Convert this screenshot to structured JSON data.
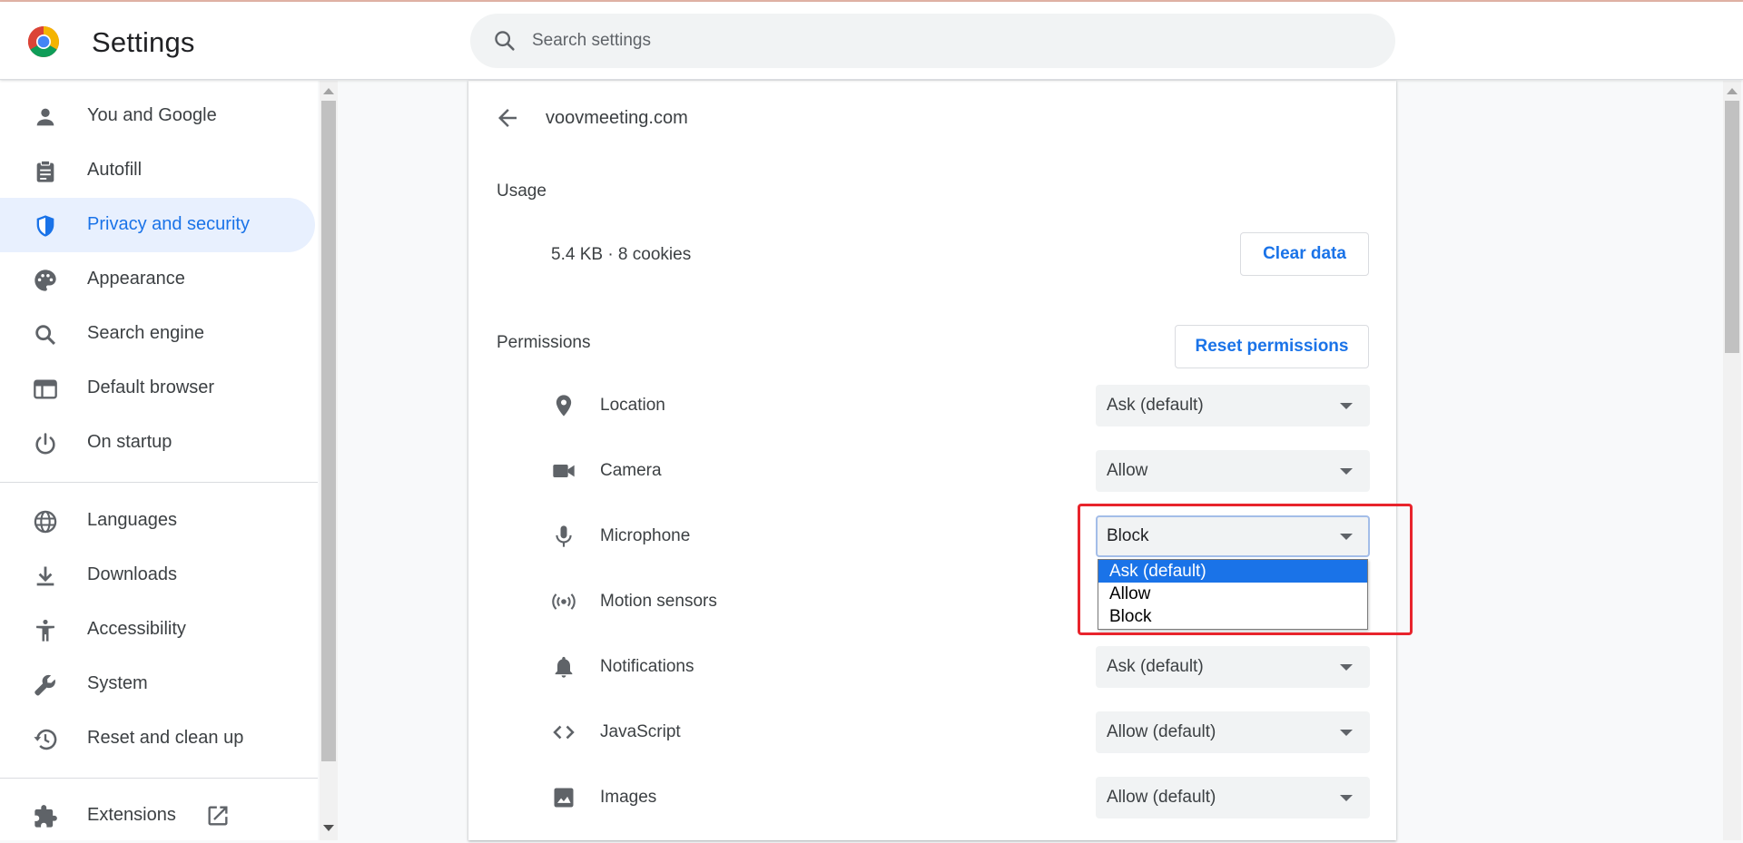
{
  "app": {
    "title": "Settings"
  },
  "search": {
    "placeholder": "Search settings"
  },
  "sidebar": {
    "items": [
      {
        "label": "You and Google",
        "icon": "person-icon"
      },
      {
        "label": "Autofill",
        "icon": "clipboard-icon"
      },
      {
        "label": "Privacy and security",
        "icon": "shield-icon",
        "active": true
      },
      {
        "label": "Appearance",
        "icon": "palette-icon"
      },
      {
        "label": "Search engine",
        "icon": "search-icon"
      },
      {
        "label": "Default browser",
        "icon": "browser-window-icon"
      },
      {
        "label": "On startup",
        "icon": "power-icon"
      },
      {
        "label": "Languages",
        "icon": "globe-icon"
      },
      {
        "label": "Downloads",
        "icon": "download-icon"
      },
      {
        "label": "Accessibility",
        "icon": "accessibility-icon"
      },
      {
        "label": "System",
        "icon": "wrench-icon"
      },
      {
        "label": "Reset and clean up",
        "icon": "history-icon"
      },
      {
        "label": "Extensions",
        "icon": "puzzle-icon"
      }
    ]
  },
  "site": {
    "name": "voovmeeting.com",
    "usage_title": "Usage",
    "usage_value": "5.4 KB · 8 cookies",
    "clear_data_label": "Clear data",
    "permissions_title": "Permissions",
    "reset_permissions_label": "Reset permissions",
    "permissions": [
      {
        "label": "Location",
        "value": "Ask (default)",
        "icon": "location-pin-icon"
      },
      {
        "label": "Camera",
        "value": "Allow",
        "icon": "camera-icon"
      },
      {
        "label": "Microphone",
        "value": "Block",
        "icon": "microphone-icon",
        "focused": true
      },
      {
        "label": "Motion sensors",
        "value": "",
        "icon": "motion-sensors-icon"
      },
      {
        "label": "Notifications",
        "value": "Ask (default)",
        "icon": "bell-icon"
      },
      {
        "label": "JavaScript",
        "value": "Allow (default)",
        "icon": "code-icon"
      },
      {
        "label": "Images",
        "value": "Allow (default)",
        "icon": "image-icon"
      }
    ]
  },
  "dropdown": {
    "options": [
      "Ask (default)",
      "Allow",
      "Block"
    ],
    "highlighted": "Ask (default)"
  },
  "colors": {
    "accent": "#1a73e8",
    "active_nav_bg": "#e8f0fe",
    "annotation": "#e8242c"
  }
}
